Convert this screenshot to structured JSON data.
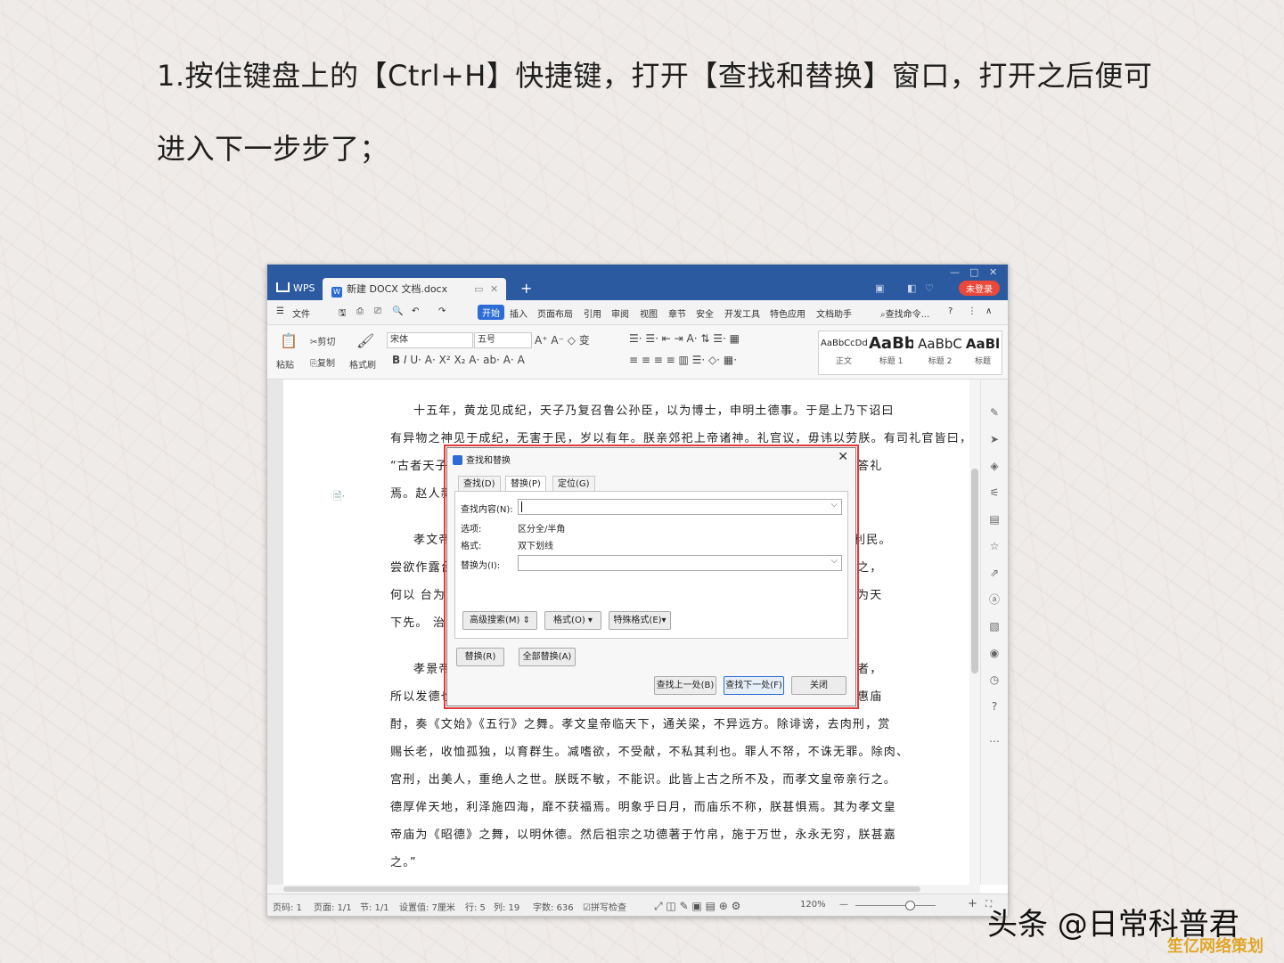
{
  "slide": {
    "line1": "1.按住键盘上的【Ctrl+H】快捷键，打开【查找和替换】窗口，打开之后便可",
    "line2": "进入下一步步了；"
  },
  "app": {
    "wps_label": "WPS",
    "doc_tab": "新建 DOCX 文档.docx",
    "login_badge": "未登录",
    "menu": [
      "文件",
      "开始",
      "插入",
      "页面布局",
      "引用",
      "审阅",
      "视图",
      "章节",
      "安全",
      "开发工具",
      "特色应用",
      "文档助手"
    ],
    "active_menu": "开始",
    "search_cmd": "查找命令...",
    "ribbon": {
      "paste": "粘贴",
      "cut": "剪切",
      "copy": "复制",
      "format_painter": "格式刷",
      "font_name": "宋体",
      "font_size": "五号"
    },
    "styles": [
      {
        "preview": "AaBbCcDd",
        "label": "正文"
      },
      {
        "preview": "AaBb",
        "label": "标题 1"
      },
      {
        "preview": "AaBbC",
        "label": "标题 2"
      },
      {
        "preview": "AaBl",
        "label": "标题"
      }
    ],
    "document": {
      "paragraphs": [
        "十五年，黄龙见成纪，天子乃复召鲁公孙臣，以为博士，申明土德事。于是上乃下诏曰",
        "有异物之神见于成纪，无害于民，岁以有年。朕亲郊祀上帝诸神。礼官议，毋讳以劳朕。有司礼官皆曰，",
        "“古者天子",
        "焉。赵人新",
        "孝文帝",
        "尝欲作露台",
        "何以 台为",
        "下先。 治",
        "孝景帝",
        "所以发德也",
        "酎，奏《文始》《五行》之舞。孝文皇帝临天下，通关梁，不异远方。除诽谤，去肉刑，赏",
        "赐长老，收恤孤独，以育群生。减嗜欲，不受献，不私其利也。罪人不帑，不诛无罪。除肉、",
        "宫刑，出美人，重绝人之世。朕既不敏，不能识。此皆上古之所不及，而孝文皇帝亲行之。",
        "德厚侔天地，利泽施四海，靡不获福焉。明象乎日月，而庙乐不称，朕甚惧焉。其为孝文皇",
        "帝庙为《昭德》之舞，以明休德。然后祖宗之功德著于竹帛，施于万世，永永无穷，朕甚嘉",
        "之。”"
      ],
      "right_fragments": [
        "答礼",
        "利民。",
        "之，",
        "为天",
        "者，",
        "惠庙"
      ]
    },
    "status": {
      "page": "页码: 1",
      "pages": "页面: 1/1",
      "section": "节: 1/1",
      "setting": "设置值: 7厘米",
      "row": "行: 5",
      "col": "列: 19",
      "words": "字数: 636",
      "spell": "拼写检查",
      "zoom": "120%"
    }
  },
  "dialog": {
    "title": "查找和替换",
    "tabs": [
      "查找(D)",
      "替换(P)",
      "定位(G)"
    ],
    "active_tab": "替换(P)",
    "find_label": "查找内容(N):",
    "find_value": "",
    "options_label": "选项:",
    "options_value": "区分全/半角",
    "format_label": "格式:",
    "format_value": "双下划线",
    "replace_label": "替换为(I):",
    "replace_value": "",
    "advanced": "高级搜索(M)",
    "format_btn": "格式(O)",
    "special_btn": "特殊格式(E)",
    "replace_btn": "替换(R)",
    "replace_all_btn": "全部替换(A)",
    "find_prev": "查找上一处(B)",
    "find_next": "查找下一处(F)",
    "close": "关闭"
  },
  "watermark": {
    "brand": "头条 @日常科普君",
    "site": "笙亿网络策划"
  }
}
